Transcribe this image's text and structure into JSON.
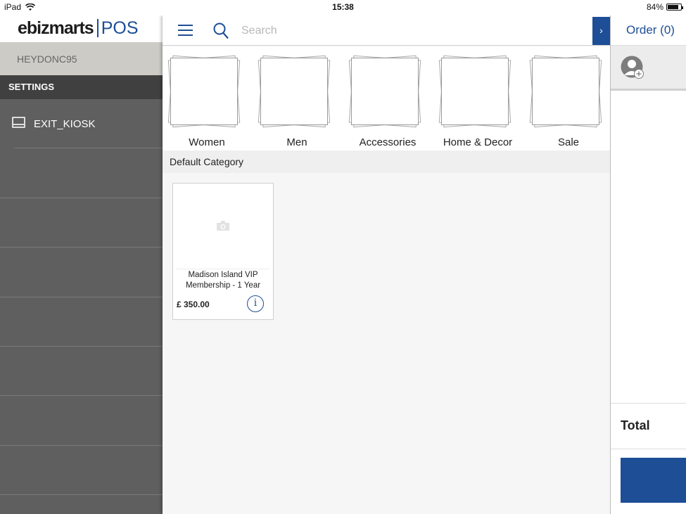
{
  "status_bar": {
    "device": "iPad",
    "time": "15:38",
    "battery": "84%",
    "battery_level": 0.84
  },
  "sidebar": {
    "logo_main": "ebizmarts",
    "logo_pos": "POS",
    "username": "HEYDONC95",
    "section": "SETTINGS",
    "items": [
      {
        "label": "EXIT_KIOSK",
        "icon": "tablet-icon"
      }
    ]
  },
  "search": {
    "placeholder": "Search",
    "value": ""
  },
  "go_button_label": "›",
  "categories": [
    {
      "label": "Women"
    },
    {
      "label": "Men"
    },
    {
      "label": "Accessories"
    },
    {
      "label": "Home & Decor"
    },
    {
      "label": "Sale"
    }
  ],
  "section_title": "Default Category",
  "products": [
    {
      "name": "Madison Island VIP Membership - 1 Year",
      "price": "£ 350.00",
      "info_label": "i"
    }
  ],
  "order": {
    "title": "Order (0)",
    "total_label": "Total"
  },
  "colors": {
    "accent": "#1d4e96",
    "sidebar_bg": "#5f5f5f",
    "settings_bg": "#404040",
    "user_row_bg": "#cdcbc6"
  }
}
